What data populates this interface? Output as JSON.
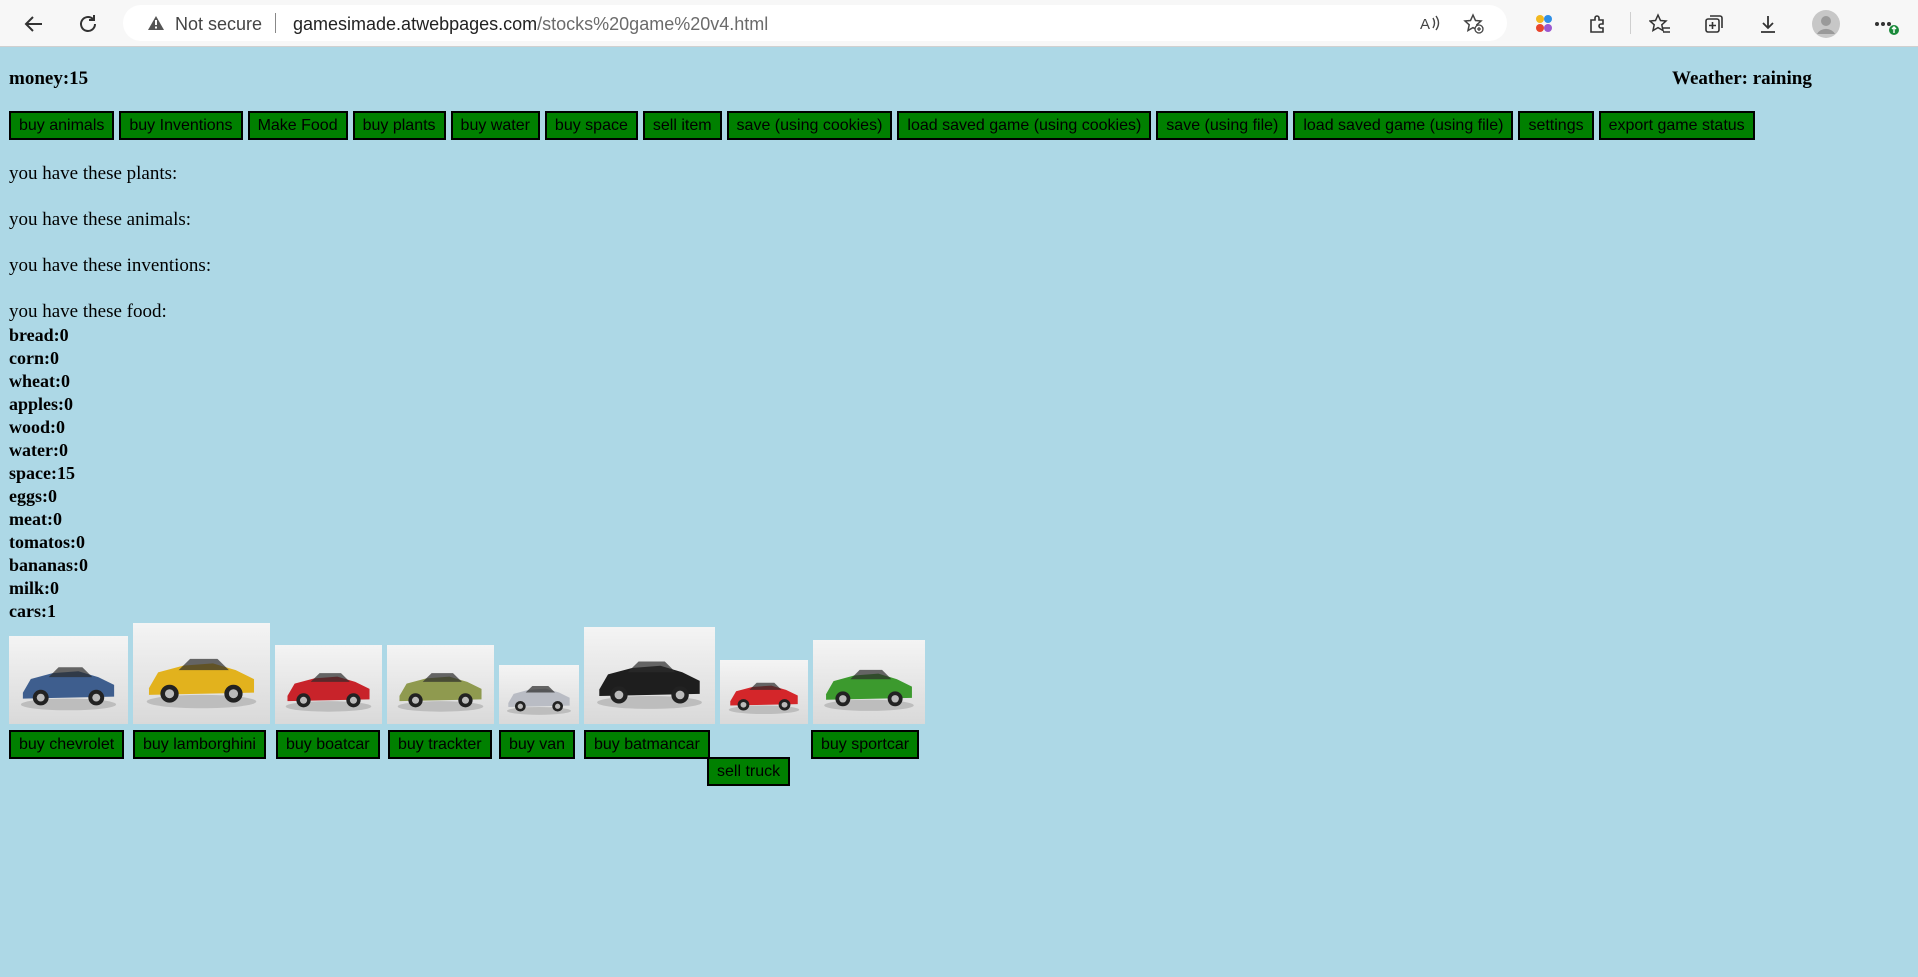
{
  "browser": {
    "security_label": "Not secure",
    "url_host": "gamesimade.atwebpages.com",
    "url_path": "/stocks%20game%20v4.html"
  },
  "game": {
    "money_label": "money:15",
    "weather_label": "Weather: raining"
  },
  "actions": [
    "buy animals",
    "buy Inventions",
    "Make Food",
    "buy plants",
    "buy water",
    "buy space",
    "sell item",
    "save (using cookies)",
    "load saved game (using cookies)",
    "save (using file)",
    "load saved game (using file)",
    "settings",
    "export game status"
  ],
  "inventory": {
    "plants_heading": "you have these plants:",
    "animals_heading": "you have these animals:",
    "inventions_heading": "you have these inventions:",
    "food_heading": "you have these food:"
  },
  "stats": [
    "bread:0",
    "corn:0",
    "wheat:0",
    "apples:0",
    "wood:0",
    "water:0",
    "space:15",
    "eggs:0",
    "meat:0",
    "tomatos:0",
    "bananas:0",
    "milk:0",
    "cars:1"
  ],
  "cars": [
    {
      "name": "chevrolet",
      "button": "buy chevrolet",
      "color": "#3e5e8e"
    },
    {
      "name": "lamborghini",
      "button": "buy lamborghini",
      "color": "#e2b21d"
    },
    {
      "name": "boatcar",
      "button": "buy boatcar",
      "color": "#c8232a"
    },
    {
      "name": "trackter",
      "button": "buy trackter",
      "color": "#8f9a4f"
    },
    {
      "name": "van",
      "button": "buy van",
      "color": "#b9bcc4"
    },
    {
      "name": "batmancar",
      "button": "buy batmancar",
      "color": "#1e1e1e"
    },
    {
      "name": "truck",
      "button": "sell truck",
      "color": "#d4262a"
    },
    {
      "name": "sportcar",
      "button": "buy sportcar",
      "color": "#3c9a2e"
    }
  ]
}
